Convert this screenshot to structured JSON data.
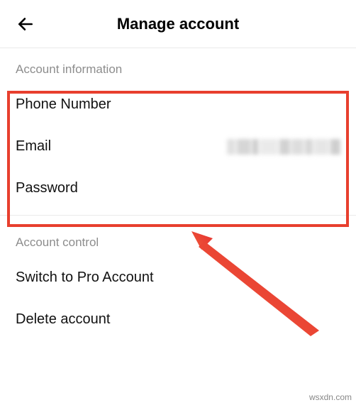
{
  "header": {
    "title": "Manage account"
  },
  "sections": {
    "info": {
      "header": "Account information",
      "phone_label": "Phone Number",
      "email_label": "Email",
      "password_label": "Password"
    },
    "control": {
      "header": "Account control",
      "switch_label": "Switch to Pro Account",
      "delete_label": "Delete account"
    }
  },
  "watermark": "wsxdn.com"
}
